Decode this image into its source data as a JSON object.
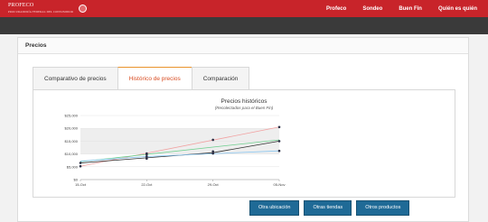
{
  "header": {
    "logo": {
      "text": "PROFECO",
      "subtext": "PROCURADURÍA FEDERAL DEL CONSUMIDOR"
    },
    "nav": [
      {
        "label": "Profeco"
      },
      {
        "label": "Sondeo"
      },
      {
        "label": "Buen Fin"
      },
      {
        "label": "Quién es quién"
      }
    ]
  },
  "panel": {
    "title": "Precios"
  },
  "tabs": [
    {
      "label": "Comparativo de precios",
      "active": false
    },
    {
      "label": "Histórico de precios",
      "active": true
    },
    {
      "label": "Comparación",
      "active": false
    }
  ],
  "buttons": [
    {
      "label": "Otra ubicación"
    },
    {
      "label": "Otras tiendas"
    },
    {
      "label": "Otros productos"
    }
  ],
  "colors": {
    "brand": "#c8242a",
    "dark_bar": "#3a3a3a",
    "button": "#1f6a96",
    "active_tab": "#d84b20"
  },
  "chart_data": {
    "type": "line",
    "title": "Precios históricos",
    "subtitle": "(Recolectados para el Buen Fin)",
    "categories": [
      "15-Oct",
      "22-Oct",
      "29-Oct",
      "05-Nov"
    ],
    "y_ticks": [
      "$0",
      "$5,000",
      "$10,000",
      "$15,000",
      "$20,000",
      "$25,000"
    ],
    "ylim": [
      0,
      25000
    ],
    "series": [
      {
        "color": "#f2a0a0",
        "points": [
          [
            0,
            5200
          ],
          [
            3,
            20500
          ]
        ]
      },
      {
        "color": "#2f2f2f",
        "points": [
          [
            0,
            6500
          ],
          [
            1,
            8500
          ],
          [
            2,
            10500
          ],
          [
            3,
            15000
          ]
        ]
      },
      {
        "color": "#6fcf8f",
        "points": [
          [
            0,
            7000
          ],
          [
            3,
            15500
          ]
        ]
      },
      {
        "color": "#8ac6f0",
        "points": [
          [
            0,
            7200
          ],
          [
            1,
            9000
          ],
          [
            3,
            11200
          ]
        ]
      }
    ],
    "markers": [
      {
        "x": 0,
        "y": 5200
      },
      {
        "x": 0,
        "y": 6500
      },
      {
        "x": 1,
        "y": 8200
      },
      {
        "x": 1,
        "y": 9000
      },
      {
        "x": 1,
        "y": 9800
      },
      {
        "x": 1,
        "y": 10200
      },
      {
        "x": 2,
        "y": 10200
      },
      {
        "x": 2,
        "y": 11000
      },
      {
        "x": 2,
        "y": 15500
      },
      {
        "x": 3,
        "y": 11200
      },
      {
        "x": 3,
        "y": 15000
      },
      {
        "x": 3,
        "y": 20500
      }
    ],
    "grid": true
  }
}
